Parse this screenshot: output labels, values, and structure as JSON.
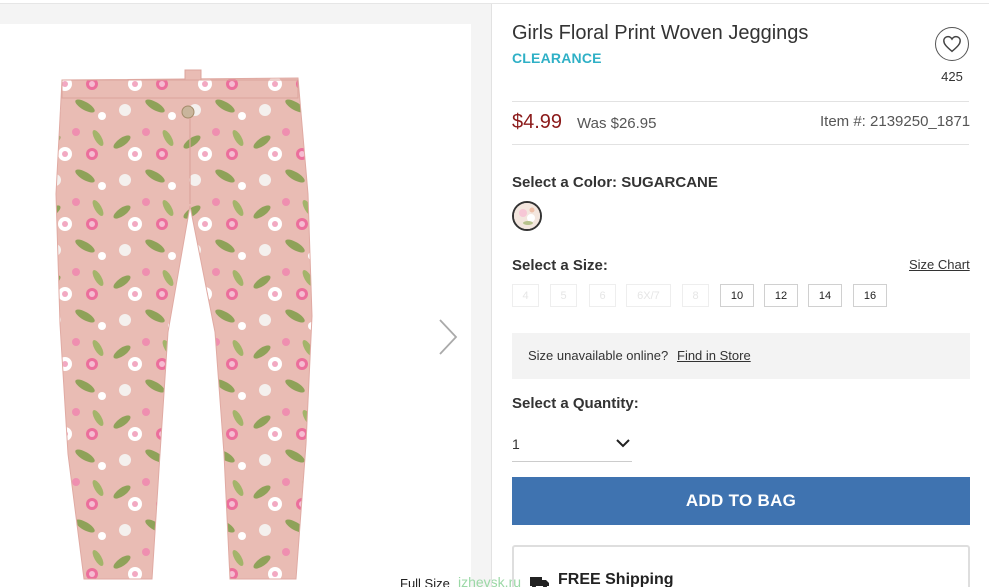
{
  "product": {
    "title": "Girls Floral Print Woven Jeggings",
    "badge": "CLEARANCE",
    "favorite_count": "425",
    "price": "$4.99",
    "was_price": "Was $26.95",
    "item_number": "Item #: 2139250_1871"
  },
  "color": {
    "label": "Select a Color: SUGARCANE"
  },
  "size": {
    "label": "Select a Size:",
    "chart_link": "Size Chart",
    "options": [
      {
        "label": "4",
        "available": false
      },
      {
        "label": "5",
        "available": false
      },
      {
        "label": "6",
        "available": false
      },
      {
        "label": "6X/7",
        "available": false
      },
      {
        "label": "8",
        "available": false
      },
      {
        "label": "10",
        "available": true
      },
      {
        "label": "12",
        "available": true
      },
      {
        "label": "14",
        "available": true
      },
      {
        "label": "16",
        "available": true
      }
    ]
  },
  "store": {
    "question": "Size unavailable online?",
    "link": "Find in Store"
  },
  "quantity": {
    "label": "Select a Quantity:",
    "value": "1"
  },
  "actions": {
    "add_to_bag": "ADD TO BAG"
  },
  "shipping": {
    "text": "FREE Shipping"
  },
  "gallery": {
    "full_size": "Full Size",
    "watermark": "izhevsk.ru"
  },
  "icons": {
    "favorite": "heart-icon",
    "next": "chevron-right-icon",
    "quantity": "chevron-down-icon",
    "shipping": "truck-icon"
  },
  "colors": {
    "price": "#8b1a1a",
    "badge": "#2fb0c6",
    "button": "#3f73b0",
    "product_pink": "#eab8b2"
  }
}
